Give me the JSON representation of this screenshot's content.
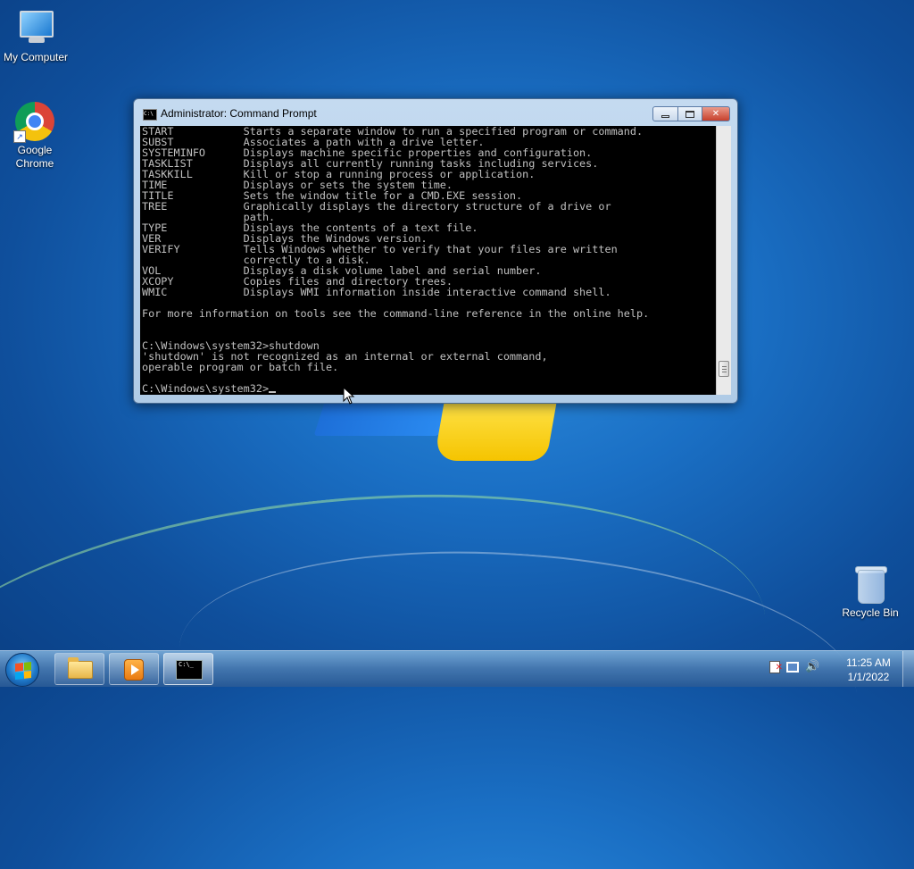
{
  "desktop": {
    "icons": [
      {
        "label": "My Computer",
        "icon": "computer-icon"
      },
      {
        "label": "Google\nChrome",
        "icon": "chrome-icon"
      },
      {
        "label": "Recycle Bin",
        "icon": "recycle-bin-icon"
      }
    ]
  },
  "cmd_window": {
    "title": "Administrator: Command Prompt",
    "console_lines": [
      "START           Starts a separate window to run a specified program or command.",
      "SUBST           Associates a path with a drive letter.",
      "SYSTEMINFO      Displays machine specific properties and configuration.",
      "TASKLIST        Displays all currently running tasks including services.",
      "TASKKILL        Kill or stop a running process or application.",
      "TIME            Displays or sets the system time.",
      "TITLE           Sets the window title for a CMD.EXE session.",
      "TREE            Graphically displays the directory structure of a drive or",
      "                path.",
      "TYPE            Displays the contents of a text file.",
      "VER             Displays the Windows version.",
      "VERIFY          Tells Windows whether to verify that your files are written",
      "                correctly to a disk.",
      "VOL             Displays a disk volume label and serial number.",
      "XCOPY           Copies files and directory trees.",
      "WMIC            Displays WMI information inside interactive command shell.",
      "",
      "For more information on tools see the command-line reference in the online help.",
      "",
      "",
      "C:\\Windows\\system32>shutdown",
      "'shutdown' is not recognized as an internal or external command,",
      "operable program or batch file.",
      ""
    ],
    "prompt": "C:\\Windows\\system32>"
  },
  "taskbar": {
    "pinned": [
      {
        "name": "windows-explorer",
        "icon": "folder-icon"
      },
      {
        "name": "windows-media-player",
        "icon": "media-player-icon"
      },
      {
        "name": "command-prompt",
        "icon": "cmd-icon",
        "active": true
      }
    ],
    "tray_icons": [
      "action-center-flag-icon",
      "network-icon",
      "volume-icon"
    ],
    "clock_time": "11:25 AM",
    "clock_date": "1/1/2022"
  },
  "colors": {
    "console_bg": "#000000",
    "console_text": "#c0c0c0",
    "desktop_blue": "#1a6fc4"
  }
}
